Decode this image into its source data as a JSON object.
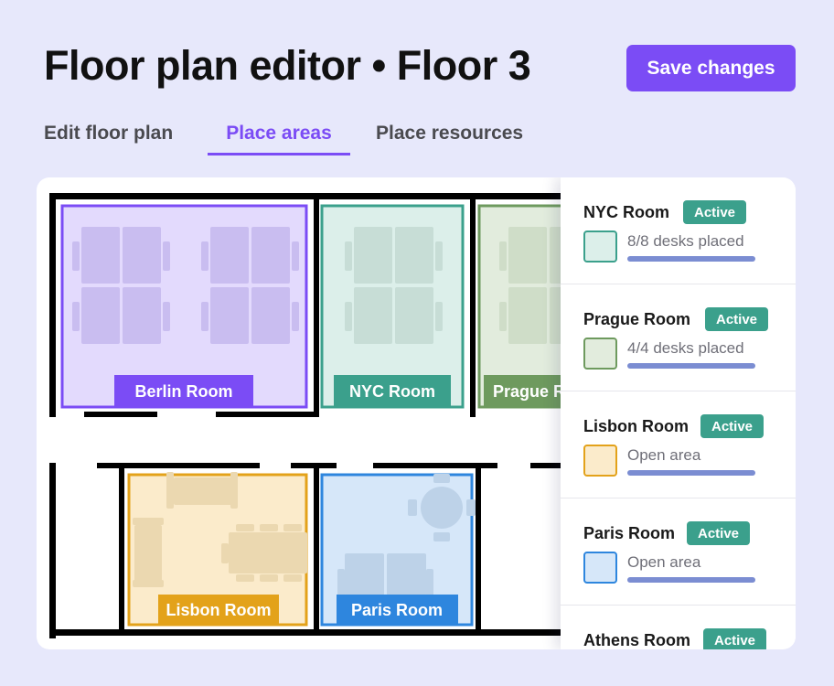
{
  "header": {
    "title": "Floor plan editor • Floor 3",
    "save_label": "Save changes"
  },
  "tabs": [
    {
      "label": "Edit floor plan",
      "active": false
    },
    {
      "label": "Place areas",
      "active": true
    },
    {
      "label": "Place resources",
      "active": false
    }
  ],
  "floor_plan": {
    "rooms": [
      {
        "name": "Berlin Room",
        "color": "#7B4CF5",
        "fill": "#E3DAFD"
      },
      {
        "name": "NYC Room",
        "color": "#3BA08C",
        "fill": "#DCEFEA"
      },
      {
        "name": "Prague Room",
        "color": "#6E9A5E",
        "fill": "#E2ECDD"
      },
      {
        "name": "Lisbon Room",
        "color": "#E3A21A",
        "fill": "#FBEBCB"
      },
      {
        "name": "Paris Room",
        "color": "#2E86DE",
        "fill": "#D6E7F9"
      }
    ]
  },
  "sidebar": {
    "items": [
      {
        "name": "NYC Room",
        "badge": "Active",
        "status": "8/8 desks placed",
        "swatch_fill": "#DCEFEA",
        "swatch_border": "#3BA08C"
      },
      {
        "name": "Prague Room",
        "badge": "Active",
        "status": "4/4 desks placed",
        "swatch_fill": "#E2ECDD",
        "swatch_border": "#6E9A5E"
      },
      {
        "name": "Lisbon Room",
        "badge": "Active",
        "status": "Open area",
        "swatch_fill": "#FBEBCB",
        "swatch_border": "#E3A21A"
      },
      {
        "name": "Paris Room",
        "badge": "Active",
        "status": "Open area",
        "swatch_fill": "#D6E7F9",
        "swatch_border": "#2E86DE"
      },
      {
        "name": "Athens Room",
        "badge": "Active",
        "status": "",
        "swatch_fill": "",
        "swatch_border": ""
      }
    ]
  }
}
